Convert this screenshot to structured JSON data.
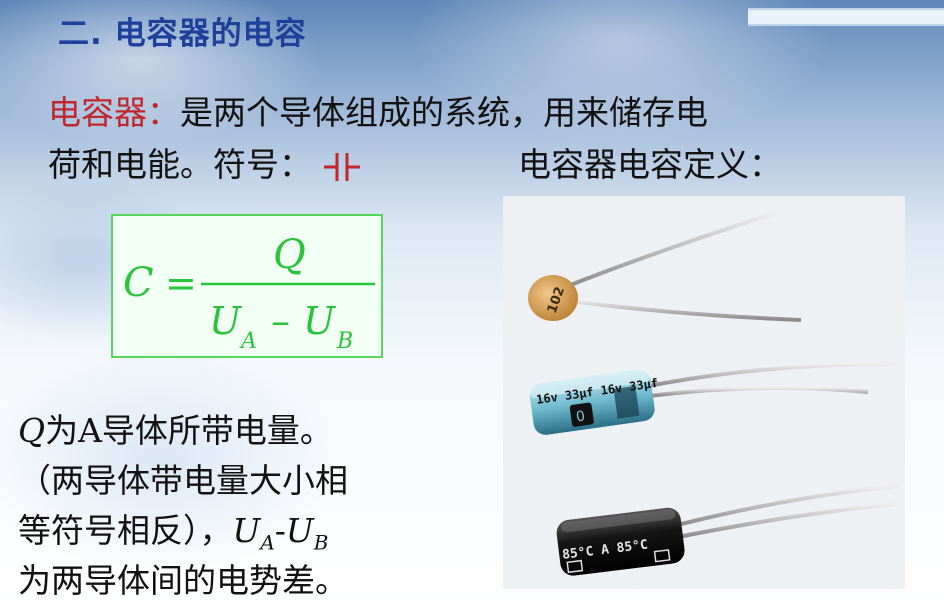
{
  "heading": "二. 电容器的电容",
  "intro": {
    "term": "电容器：",
    "line1_rest": "是两个导体组成的系统，用来储存电",
    "line2_text": "荷和电能。符号：",
    "definition_label": "电容器电容定义："
  },
  "formula": {
    "lhs": "C",
    "equals": "=",
    "numerator": "Q",
    "denominator": {
      "ua": "U",
      "ua_sub": "A",
      "minus": "–",
      "ub": "U",
      "ub_sub": "B"
    }
  },
  "notes": {
    "line1_var": "Q",
    "line1_text": "为A导体所带电量。",
    "line2": "（两导体带电量大小相",
    "line3_text": "等符号相反），",
    "line3_u1": "U",
    "line3_s1": "A",
    "line3_dash": "-",
    "line3_u2": "U",
    "line3_s2": "B",
    "line4": "为两导体间的电势差。"
  },
  "photo": {
    "ceramic_marking": "102",
    "electrolytic_marking_1": "16v 33µf 16v 33µf",
    "electrolytic_marking_2": "85°C A 85°C"
  },
  "colors": {
    "heading": "#1f3f9a",
    "term": "#c0262c",
    "formula": "#2ac43a",
    "box_border": "#56d65f"
  }
}
